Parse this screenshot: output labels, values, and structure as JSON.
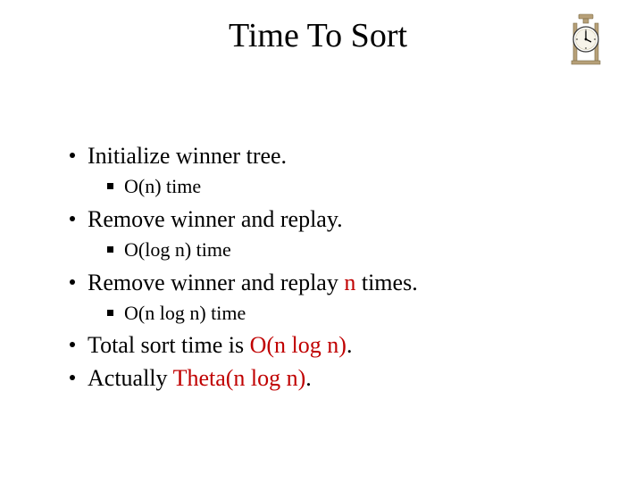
{
  "title": "Time To Sort",
  "bullets": {
    "b1": "Initialize winner tree.",
    "b1a": "O(n) time",
    "b2": "Remove winner and replay.",
    "b2a": "O(log n) time",
    "b3_pre": "Remove winner and replay ",
    "b3_hl": "n",
    "b3_post": " times.",
    "b3a": "O(n log n) time",
    "b4_pre": "Total sort time is ",
    "b4_hl": "O(n log n)",
    "b4_post": ".",
    "b5_pre": "Actually ",
    "b5_hl": "Theta(n log n)",
    "b5_post": "."
  },
  "icon": "clock-icon"
}
